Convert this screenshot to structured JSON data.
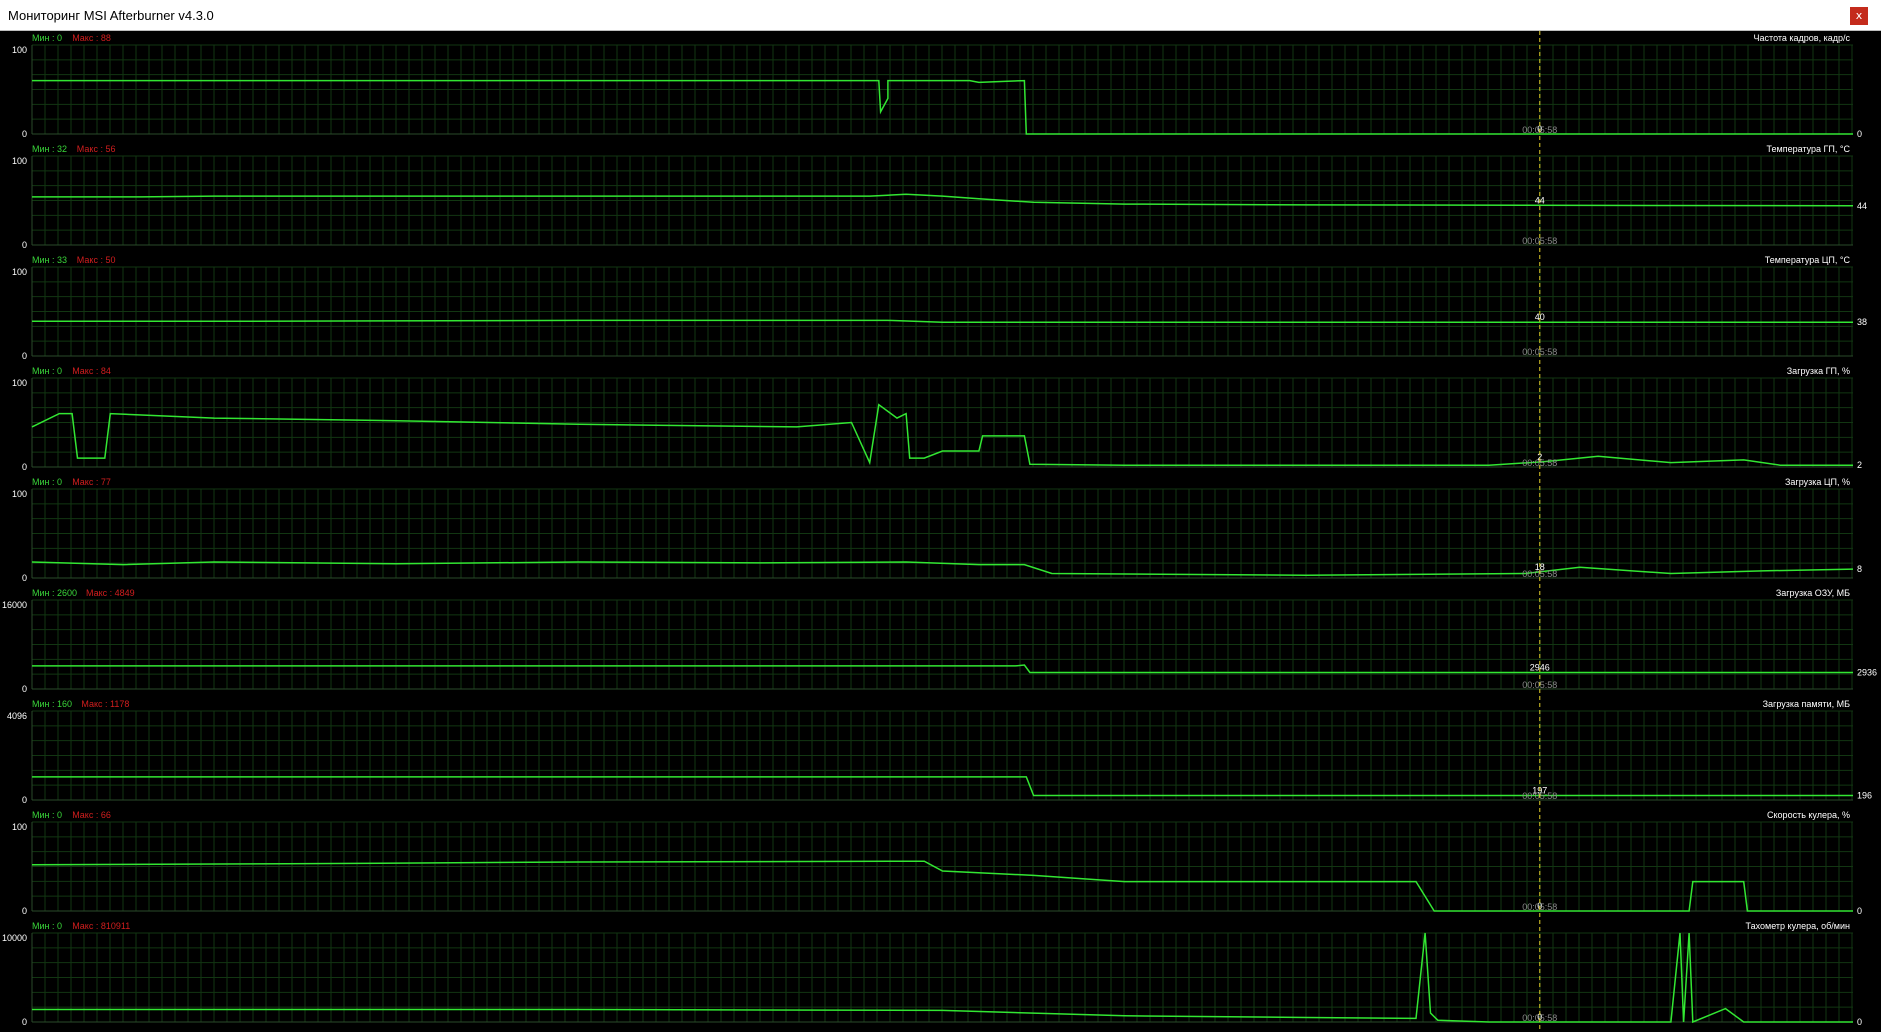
{
  "window": {
    "title": "Мониторинг MSI Afterburner v4.3.0",
    "close_label": "x"
  },
  "colors": {
    "background": "#000000",
    "grid": "#123612",
    "graph_line": "#32e632",
    "min_text": "#39d539",
    "max_text": "#d21e1e",
    "value_text": "#ffffff",
    "cursor_line": "#e6d22a"
  },
  "cursor": {
    "time": "00:05:58"
  },
  "graphs": [
    {
      "title": "Частота кадров, кадр/с",
      "min_label": "Мин : 0",
      "max_label": "Макс : 88",
      "y_max": "100",
      "y_min": "0",
      "current": "0",
      "cursor_value": "0",
      "line": [
        [
          0,
          0.6
        ],
        [
          0.465,
          0.6
        ],
        [
          0.466,
          0.25
        ],
        [
          0.47,
          0.4
        ],
        [
          0.47,
          0.6
        ],
        [
          0.515,
          0.6
        ],
        [
          0.52,
          0.58
        ],
        [
          0.545,
          0.6
        ],
        [
          0.546,
          0
        ],
        [
          1,
          0
        ]
      ]
    },
    {
      "title": "Температура ГП, °C",
      "min_label": "Мин : 32",
      "max_label": "Макс : 56",
      "y_max": "100",
      "y_min": "0",
      "current": "44",
      "cursor_value": "44",
      "line": [
        [
          0,
          0.54
        ],
        [
          0.06,
          0.54
        ],
        [
          0.1,
          0.55
        ],
        [
          0.3,
          0.55
        ],
        [
          0.46,
          0.55
        ],
        [
          0.48,
          0.57
        ],
        [
          0.5,
          0.55
        ],
        [
          0.52,
          0.52
        ],
        [
          0.55,
          0.48
        ],
        [
          0.6,
          0.46
        ],
        [
          0.7,
          0.45
        ],
        [
          1,
          0.44
        ]
      ]
    },
    {
      "title": "Температура ЦП, °C",
      "min_label": "Мин : 33",
      "max_label": "Макс : 50",
      "y_max": "100",
      "y_min": "0",
      "current": "38",
      "cursor_value": "40",
      "line": [
        [
          0,
          0.39
        ],
        [
          0.1,
          0.39
        ],
        [
          0.3,
          0.4
        ],
        [
          0.47,
          0.4
        ],
        [
          0.5,
          0.38
        ],
        [
          0.6,
          0.38
        ],
        [
          0.8,
          0.38
        ],
        [
          0.9,
          0.38
        ],
        [
          1,
          0.38
        ]
      ]
    },
    {
      "title": "Загрузка ГП, %",
      "min_label": "Мин : 0",
      "max_label": "Макс : 84",
      "y_max": "100",
      "y_min": "0",
      "current": "2",
      "cursor_value": "2",
      "line": [
        [
          0,
          0.45
        ],
        [
          0.015,
          0.6
        ],
        [
          0.022,
          0.6
        ],
        [
          0.025,
          0.1
        ],
        [
          0.04,
          0.1
        ],
        [
          0.043,
          0.6
        ],
        [
          0.1,
          0.55
        ],
        [
          0.2,
          0.52
        ],
        [
          0.3,
          0.48
        ],
        [
          0.42,
          0.45
        ],
        [
          0.45,
          0.5
        ],
        [
          0.46,
          0.05
        ],
        [
          0.465,
          0.7
        ],
        [
          0.475,
          0.55
        ],
        [
          0.48,
          0.6
        ],
        [
          0.482,
          0.1
        ],
        [
          0.49,
          0.1
        ],
        [
          0.5,
          0.18
        ],
        [
          0.52,
          0.18
        ],
        [
          0.522,
          0.35
        ],
        [
          0.545,
          0.35
        ],
        [
          0.548,
          0.03
        ],
        [
          0.6,
          0.02
        ],
        [
          0.8,
          0.02
        ],
        [
          0.83,
          0.06
        ],
        [
          0.86,
          0.12
        ],
        [
          0.9,
          0.05
        ],
        [
          0.94,
          0.08
        ],
        [
          0.96,
          0.02
        ],
        [
          1,
          0.02
        ]
      ]
    },
    {
      "title": "Загрузка ЦП, %",
      "min_label": "Мин : 0",
      "max_label": "Макс : 77",
      "y_max": "100",
      "y_min": "0",
      "current": "8",
      "cursor_value": "18",
      "line": [
        [
          0,
          0.18
        ],
        [
          0.05,
          0.15
        ],
        [
          0.1,
          0.18
        ],
        [
          0.2,
          0.16
        ],
        [
          0.3,
          0.18
        ],
        [
          0.4,
          0.17
        ],
        [
          0.48,
          0.18
        ],
        [
          0.52,
          0.15
        ],
        [
          0.545,
          0.15
        ],
        [
          0.56,
          0.05
        ],
        [
          0.7,
          0.03
        ],
        [
          0.82,
          0.05
        ],
        [
          0.85,
          0.12
        ],
        [
          0.9,
          0.05
        ],
        [
          0.95,
          0.08
        ],
        [
          1,
          0.1
        ]
      ]
    },
    {
      "title": "Загрузка ОЗУ, МБ",
      "min_label": "Мин : 2600",
      "max_label": "Макс : 4849",
      "y_max": "16000",
      "y_min": "0",
      "current": "2936",
      "cursor_value": "2946",
      "line": [
        [
          0,
          0.26
        ],
        [
          0.54,
          0.26
        ],
        [
          0.545,
          0.27
        ],
        [
          0.548,
          0.185
        ],
        [
          1,
          0.185
        ]
      ]
    },
    {
      "title": "Загрузка памяти, МБ",
      "min_label": "Мин : 160",
      "max_label": "Макс : 1178",
      "y_max": "4096",
      "y_min": "0",
      "current": "196",
      "cursor_value": "197",
      "line": [
        [
          0,
          0.26
        ],
        [
          0.54,
          0.26
        ],
        [
          0.546,
          0.26
        ],
        [
          0.55,
          0.05
        ],
        [
          1,
          0.05
        ]
      ]
    },
    {
      "title": "Скорость кулера, %",
      "min_label": "Мин : 0",
      "max_label": "Макс : 66",
      "y_max": "100",
      "y_min": "0",
      "current": "0",
      "cursor_value": "0",
      "line": [
        [
          0,
          0.52
        ],
        [
          0.14,
          0.53
        ],
        [
          0.3,
          0.55
        ],
        [
          0.49,
          0.56
        ],
        [
          0.5,
          0.45
        ],
        [
          0.55,
          0.4
        ],
        [
          0.6,
          0.33
        ],
        [
          0.65,
          0.33
        ],
        [
          0.76,
          0.33
        ],
        [
          0.77,
          0
        ],
        [
          0.91,
          0
        ],
        [
          0.912,
          0.33
        ],
        [
          0.94,
          0.33
        ],
        [
          0.942,
          0
        ],
        [
          1,
          0
        ]
      ]
    },
    {
      "title": "Тахометр кулера, об/мин",
      "min_label": "Мин : 0",
      "max_label": "Макс : 810911",
      "y_max": "10000",
      "y_min": "0",
      "current": "0",
      "cursor_value": "0",
      "line": [
        [
          0,
          0.14
        ],
        [
          0.3,
          0.14
        ],
        [
          0.5,
          0.13
        ],
        [
          0.6,
          0.07
        ],
        [
          0.7,
          0.05
        ],
        [
          0.76,
          0.04
        ],
        [
          0.765,
          1.0
        ],
        [
          0.768,
          0.1
        ],
        [
          0.772,
          0.02
        ],
        [
          0.8,
          0
        ],
        [
          0.9,
          0
        ],
        [
          0.905,
          1.0
        ],
        [
          0.907,
          0
        ],
        [
          0.91,
          1.0
        ],
        [
          0.912,
          0
        ],
        [
          0.93,
          0.15
        ],
        [
          0.94,
          0
        ],
        [
          1,
          0
        ]
      ]
    }
  ]
}
